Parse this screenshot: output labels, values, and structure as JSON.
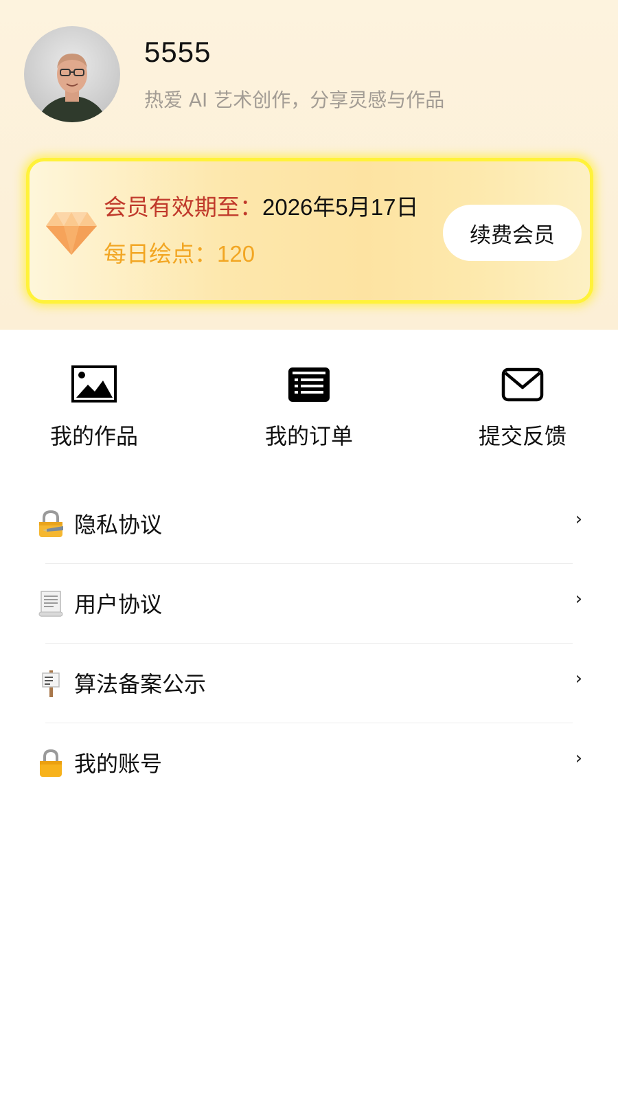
{
  "profile": {
    "username": "5555",
    "bio": "热爱 AI 艺术创作，分享灵感与作品",
    "avatar_icon": "avatar-photo"
  },
  "membership": {
    "expiry_label": "会员有效期至：",
    "expiry_date": "2026年5月17日",
    "points_label": "每日绘点：",
    "points_value": "120",
    "renew_label": "续费会员",
    "icon": "diamond-icon",
    "accent_colors": {
      "label_red": "#c0392b",
      "points_orange": "#f2a623",
      "border_yellow": "#fff23a"
    }
  },
  "quick_actions": [
    {
      "label": "我的作品",
      "icon": "image-icon"
    },
    {
      "label": "我的订单",
      "icon": "list-icon"
    },
    {
      "label": "提交反馈",
      "icon": "mail-icon"
    }
  ],
  "menu": [
    {
      "label": "隐私协议",
      "icon": "lock-with-pen-icon"
    },
    {
      "label": "用户协议",
      "icon": "document-icon"
    },
    {
      "label": "算法备案公示",
      "icon": "signpost-icon"
    },
    {
      "label": "我的账号",
      "icon": "lock-icon"
    }
  ],
  "chevron": "›"
}
